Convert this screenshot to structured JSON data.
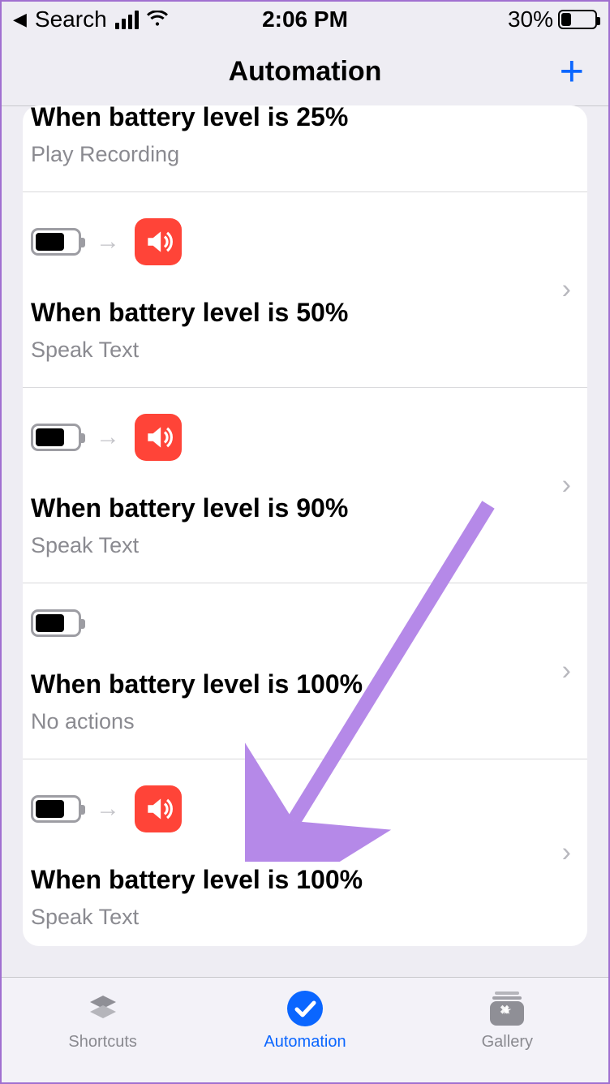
{
  "status": {
    "back_app": "Search",
    "time": "2:06 PM",
    "battery_pct": "30%",
    "battery_fill_width": "30%"
  },
  "nav": {
    "title": "Automation",
    "add_label": "+"
  },
  "rows": [
    {
      "title": "When battery level is 25%",
      "sub": "Play Recording",
      "show_icons": false,
      "cut": true
    },
    {
      "title": "When battery level is 50%",
      "sub": "Speak Text",
      "show_icons": true,
      "speak": true
    },
    {
      "title": "When battery level is 90%",
      "sub": "Speak Text",
      "show_icons": true,
      "speak": true
    },
    {
      "title": "When battery level is 100%",
      "sub": "No actions",
      "show_icons": true,
      "speak": false
    },
    {
      "title": "When battery level is 100%",
      "sub": "Speak Text",
      "show_icons": true,
      "speak": true
    }
  ],
  "tabs": {
    "shortcuts": "Shortcuts",
    "automation": "Automation",
    "gallery": "Gallery"
  }
}
